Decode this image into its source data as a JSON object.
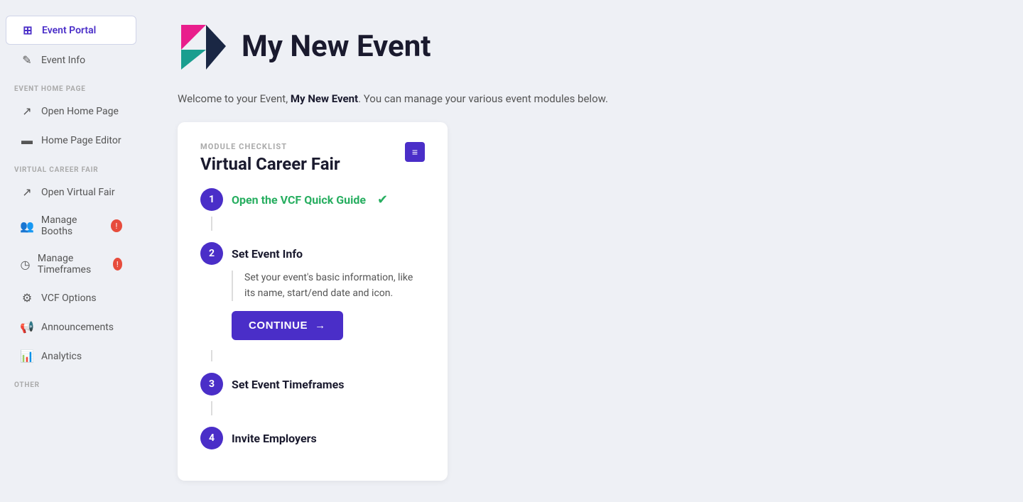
{
  "sidebar": {
    "active_item": "event-portal",
    "items_top": [
      {
        "id": "event-portal",
        "label": "Event Portal",
        "icon": "⊞"
      },
      {
        "id": "event-info",
        "label": "Event Info",
        "icon": "✎"
      }
    ],
    "section_event_home": "EVENT HOME PAGE",
    "items_home": [
      {
        "id": "open-home-page",
        "label": "Open Home Page",
        "icon": "↗"
      },
      {
        "id": "home-page-editor",
        "label": "Home Page Editor",
        "icon": "▬"
      }
    ],
    "section_vcf": "VIRTUAL CAREER FAIR",
    "items_vcf": [
      {
        "id": "open-virtual-fair",
        "label": "Open Virtual Fair",
        "icon": "↗",
        "badge": null
      },
      {
        "id": "manage-booths",
        "label": "Manage Booths",
        "icon": "👥",
        "badge": "!"
      },
      {
        "id": "manage-timeframes",
        "label": "Manage Timeframes",
        "icon": "◷",
        "badge": "!"
      },
      {
        "id": "vcf-options",
        "label": "VCF Options",
        "icon": "⚙"
      },
      {
        "id": "announcements",
        "label": "Announcements",
        "icon": "📢"
      },
      {
        "id": "analytics",
        "label": "Analytics",
        "icon": "📊"
      }
    ],
    "section_other": "OTHER"
  },
  "header": {
    "event_name": "My New Event",
    "welcome_prefix": "Welcome to your Event, ",
    "welcome_suffix": ". You can manage your various event modules below."
  },
  "checklist_card": {
    "module_label": "MODULE CHECKLIST",
    "card_title": "Virtual Career Fair",
    "list_icon": "≡",
    "steps": [
      {
        "number": "1",
        "title": "Open the VCF Quick Guide",
        "completed": true,
        "description": null,
        "has_button": false
      },
      {
        "number": "2",
        "title": "Set Event Info",
        "completed": false,
        "description": "Set your event's basic information, like its name, start/end date and icon.",
        "has_button": true,
        "button_label": "CONTINUE"
      },
      {
        "number": "3",
        "title": "Set Event Timeframes",
        "completed": false,
        "description": null,
        "has_button": false
      },
      {
        "number": "4",
        "title": "Invite Employers",
        "completed": false,
        "description": null,
        "has_button": false
      }
    ]
  }
}
